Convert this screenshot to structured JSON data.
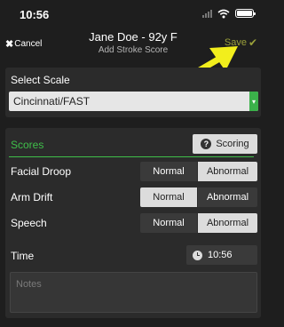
{
  "status_bar": {
    "time": "10:56"
  },
  "nav": {
    "cancel_label": "Cancel",
    "title": "Jane Doe - 92y F",
    "subtitle": "Add Stroke Score",
    "save_label": "Save"
  },
  "scale": {
    "label": "Select Scale",
    "selected": "Cincinnati/FAST"
  },
  "scores": {
    "title": "Scores",
    "scoring_label": "Scoring",
    "rows": [
      {
        "label": "Facial Droop",
        "option_normal": "Normal",
        "option_abnormal": "Abnormal",
        "selected": "Abnormal"
      },
      {
        "label": "Arm Drift",
        "option_normal": "Normal",
        "option_abnormal": "Abnormal",
        "selected": "Normal"
      },
      {
        "label": "Speech",
        "option_normal": "Normal",
        "option_abnormal": "Abnormal",
        "selected": "Abnormal"
      }
    ],
    "time_label": "Time",
    "time_value": "10:56",
    "notes_placeholder": "Notes"
  },
  "colors": {
    "background": "#1e1e1e",
    "panel": "#2b2b2b",
    "accent_green": "#3fbf4a",
    "save_olive": "#9aa03a",
    "annotation_arrow": "#f2ee1c"
  }
}
